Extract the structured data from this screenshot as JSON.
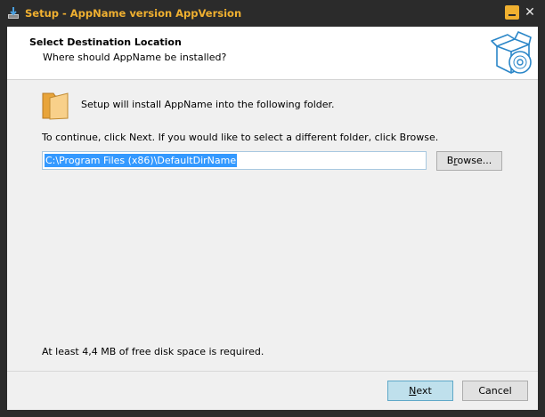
{
  "window": {
    "title": "Setup - AppName version AppVersion",
    "close_glyph": "✕"
  },
  "header": {
    "title": "Select Destination Location",
    "subtitle": "Where should AppName be installed?",
    "image_icon": "box-cd-icon"
  },
  "body": {
    "folder_icon": "folder-icon",
    "install_text": "Setup will install AppName into the following folder.",
    "continue_text": "To continue, click Next. If you would like to select a different folder, click Browse.",
    "path_value": "C:\\Program Files (x86)\\DefaultDirName",
    "browse_label_pre": "B",
    "browse_label_accel": "r",
    "browse_label_post": "owse...",
    "space_text": "At least 4,4 MB of free disk space is required."
  },
  "footer": {
    "next_accel": "N",
    "next_rest": "ext",
    "cancel_label": "Cancel"
  },
  "colors": {
    "titlebar_bg": "#2b2b2b",
    "title_text": "#f0b030",
    "client_bg": "#f0f0f0",
    "selection": "#3399ff",
    "next_button": "#bfe0ec"
  }
}
